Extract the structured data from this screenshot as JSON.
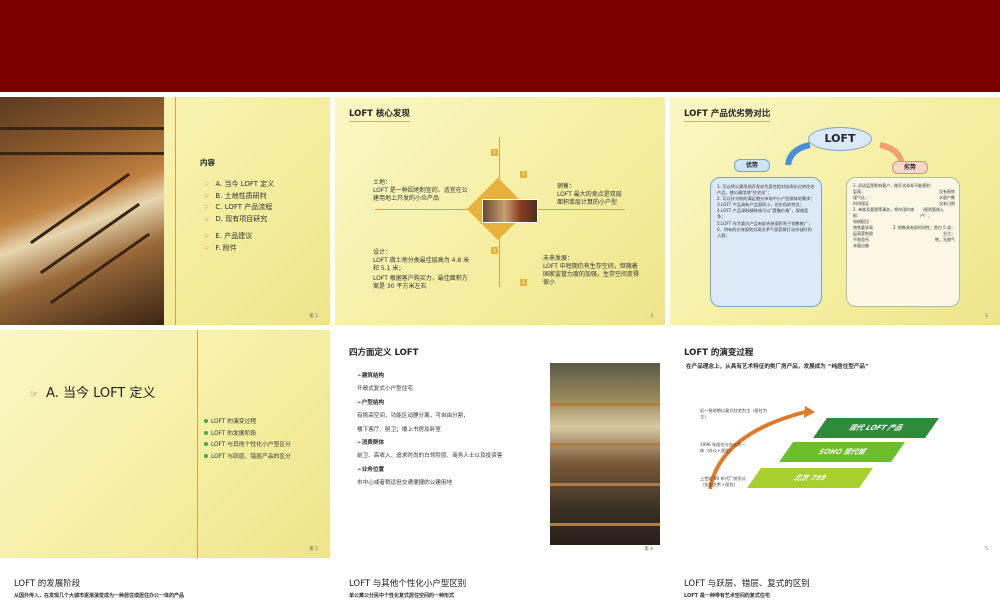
{
  "colors": {
    "topbar": "#7c0000",
    "slide_bg": "#f6f0a8",
    "accent_gold": "#d9a43a",
    "green_dark": "#2e8b3a",
    "green_mid": "#6cbf2a",
    "green_light": "#a7cf2e"
  },
  "slide1": {
    "toc_title": "内容",
    "items": [
      {
        "label": "A.  当今 LOFT 定义"
      },
      {
        "label": "B.  土地性质研判"
      },
      {
        "label": "C.  LOFT 产品流程"
      },
      {
        "label": "D.  现有项目研究"
      },
      {
        "label": "E.  产品建议"
      },
      {
        "label": "F.  附件"
      }
    ],
    "page": "第 2"
  },
  "slide2": {
    "title": "LOFT 核心发现",
    "q1_head": "土地：",
    "q1_body": "LOFT 是一种因地制宜的、适宜在公建用地上开发的小众产品",
    "q2_head": "销售：",
    "q2_body": "LOFT 最大的卖点是双层面积单层计算的小户型",
    "q3_head": "设计：",
    "q3_a": "LOFT 做土地分类最佳层高为 4.8 米和 5.1 米；",
    "q3_b": "LOFT 根据客户购买力，最佳面积方案是 30 平方米左右",
    "q4_head": "未来发展：",
    "q4_body": "LOFT 中短期仍有生存空间，但随着国家监管力度的加强，生存空间变得很小",
    "nums": [
      "1",
      "2",
      "3",
      "4"
    ],
    "page": "3"
  },
  "slide3": {
    "title": "LOFT 产品优劣势对比",
    "logo": "LOFT",
    "adv_label": "优势",
    "dis_label": "劣势",
    "adv_lines": [
      "1. 可以将公建用地开发成为居住相对较高价位的住宅产品，使公建用地“住宅化”；",
      "2. 可以针对较的满足细分市场中小户型群体的需求；",
      "3.LOFT 产品具有产品面积小，总价低的特点；",
      "4.LOFT 产品采取精装修可以“提融价格”，规避竞争；",
      "5.LOFT 作为复式产品有综合装面积利于销售推广；",
      "6．特有的文体规划对高艺术气息容易打动年轻时尚人群；"
    ],
    "dis_lines": [
      "1. 初适层是影响客户，做开式却却不能便利：",
      "层高；",
      "没有厨房",
      "煤气灶；",
      "水星户数",
      "时间保证",
      "没有日照",
      "2. 单栋及管理等事务，将作用时来报：",
      "电梯配比",
      "（规则管线入户）；",
      "商铁要求高",
      "3. 销售具有很时间性，首付 5 成；",
      "层高受制限",
      "业主；",
      "不限会所",
      "售；无燃气",
      "未屋自备"
    ],
    "page": "5"
  },
  "slide4": {
    "title": "A.  当今 LOFT 定义",
    "items": [
      "LOFT 的演变过程",
      "LOFT 的发展阶段",
      "LOFT 与其他个性化小户型区分",
      "LOFT 与跃层、错层产品的区分"
    ],
    "page": "第 2"
  },
  "slide5": {
    "title": "四方面定义 LOFT",
    "sections": [
      {
        "head": "建筑结构",
        "body": "开敞式复式小户型住宅"
      },
      {
        "head": "户型结构",
        "body": "有挑高空间，功能区动静分离，可自由分割，",
        "body2": "楼下客厅、厨卫；楼上书房及卧室"
      },
      {
        "head": "消费群体",
        "body": "前卫、高收入、追求时尚的白领阶层、商务人士以及投资客"
      },
      {
        "head": "业务位置",
        "body": "市中心或者稍远但交通便捷的公建用地"
      }
    ],
    "page": "第 4"
  },
  "slide6": {
    "title": "LOFT 的演变过程",
    "subtitle": "在产品理念上，从具有艺术特征的类厂房产品，发展成为 “纯居住型产品”",
    "notes": [
      "近一批时期以复式住宅为主（居住为主）",
      "1996 年居住与办公为一体（办公＋居住）",
      "上世纪 90 年代厂房形式（文化艺术＋居住）"
    ],
    "steps": [
      "现代 LOFT 产品",
      "SOHO  现代城",
      "北京 798"
    ],
    "page": "5"
  },
  "slide7": {
    "title": "LOFT 的发展阶段",
    "sub": "从国外传入，在发现几个大城市逐渐演变成为一种居住或居住办公一体的产品"
  },
  "slide8": {
    "title": "LOFT 与其他个性化小户型区别",
    "sub": "单公寓公分民中个性化复式居住空间的一种形式"
  },
  "slide9": {
    "title": "LOFT 与跃层、错层、复式的区别",
    "sub": "LOFT 是一种带有艺术空间的复式住宅"
  }
}
